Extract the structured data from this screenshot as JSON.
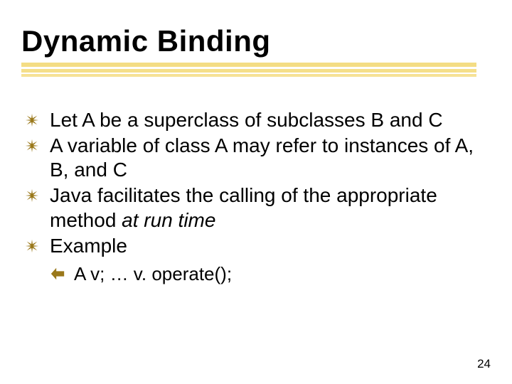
{
  "title": "Dynamic Binding",
  "bullets": [
    {
      "pre": "Let A be a superclass of subclasses B and C",
      "em": "",
      "post": ""
    },
    {
      "pre": "A variable of class A may refer to instances of A, B, and C",
      "em": "",
      "post": ""
    },
    {
      "pre": "Java facilitates the calling of the appropriate method ",
      "em": "at run time",
      "post": ""
    },
    {
      "pre": "Example",
      "em": "",
      "post": ""
    }
  ],
  "sub_bullet": "A v;  …   v. operate();",
  "page_number": "24",
  "icons": {
    "main": "burst-icon",
    "sub": "arrow-left-icon"
  }
}
